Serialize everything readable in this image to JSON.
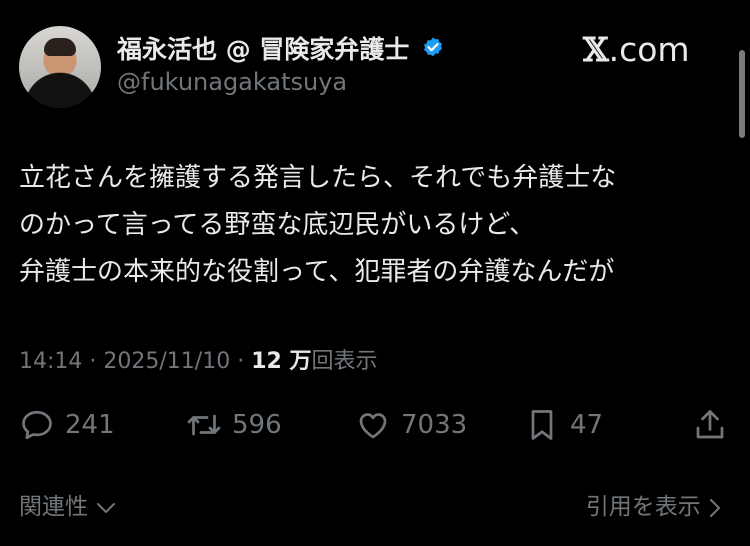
{
  "author": {
    "display_name": "福永活也 @ 冒険家弁護士",
    "handle": "@fukunagakatsuya",
    "verified_color": "#1d9bf0"
  },
  "brand": {
    "logo_x": "𝕏",
    "logo_suffix": ".com"
  },
  "tweet": {
    "lines": [
      "立花さんを擁護する発言したら、それでも弁護士な",
      "のかって言ってる野蛮な底辺民がいるけど、",
      "弁護士の本来的な役割って、犯罪者の弁護なんだが"
    ]
  },
  "meta": {
    "time": "14:14",
    "separator": "·",
    "date": "2025/11/10",
    "views_count": "12 万",
    "views_label": "回表示"
  },
  "actions": {
    "replies": "241",
    "reposts": "596",
    "likes": "7033",
    "bookmarks": "47"
  },
  "footer": {
    "related_label": "関連性",
    "quotes_label": "引用を表示"
  }
}
